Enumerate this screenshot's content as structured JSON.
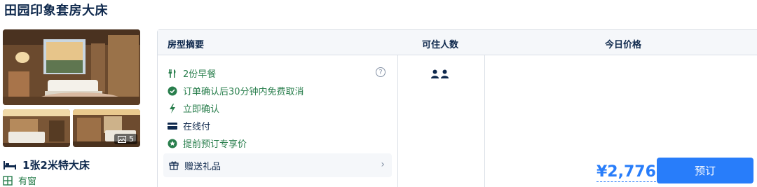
{
  "room": {
    "title": "田园印象套房大床",
    "bed": "1张2米特大床",
    "window": "有窗",
    "photo_count": "5"
  },
  "table": {
    "headers": {
      "summary": "房型摘要",
      "guests": "可住人数",
      "price": "今日价格"
    },
    "features": [
      {
        "icon": "fork-knife-icon",
        "label": "2份早餐"
      },
      {
        "icon": "check-circle-icon",
        "label": "订单确认后30分钟内免费取消"
      },
      {
        "icon": "lightning-icon",
        "label": "立即确认"
      },
      {
        "icon": "card-icon",
        "label": "在线付"
      },
      {
        "icon": "star-badge-icon",
        "label": "提前预订专享价"
      }
    ],
    "gift": "赠送礼品",
    "guest_count": 2,
    "price": "¥2,776",
    "book_label": "预订"
  },
  "colors": {
    "accent": "#287dfa",
    "green": "#287e4c",
    "text": "#0f294d"
  }
}
